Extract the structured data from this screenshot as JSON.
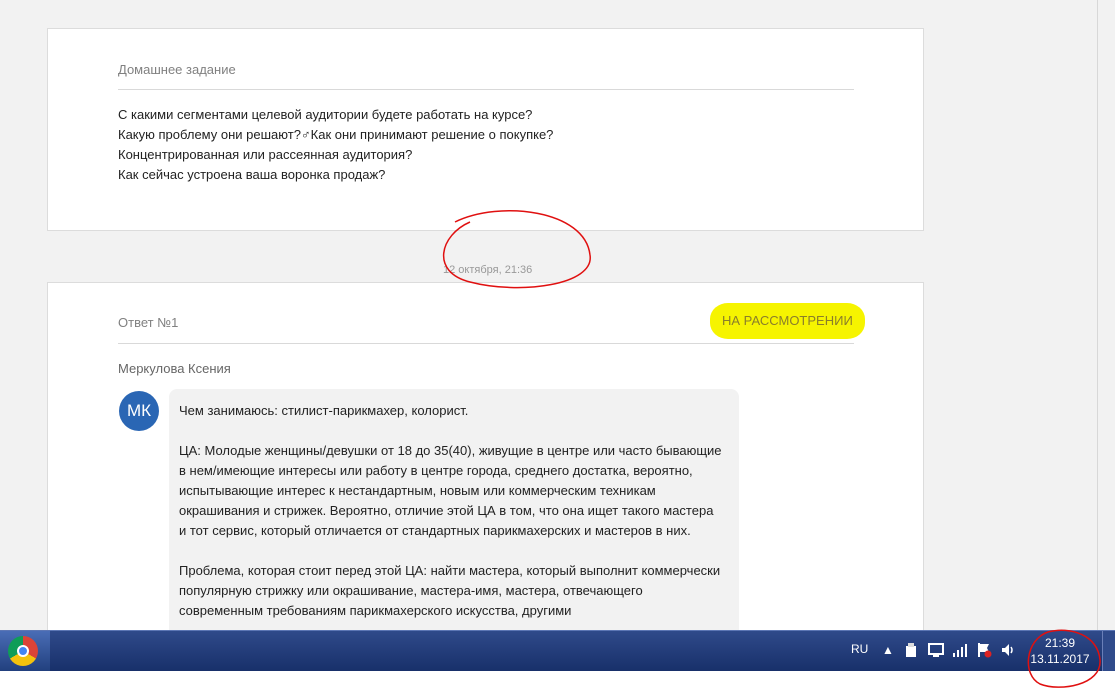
{
  "homework": {
    "title": "Домашнее задание",
    "lines": [
      "С какими сегментами целевой аудитории будете работать на курсе?",
      "Какую проблему они решают?♂Как они принимают решение о покупке?",
      "Концентрированная или рассеянная аудитория?",
      "Как сейчас устроена ваша воронка продаж?"
    ]
  },
  "timestamp": "12 октября, 21:36",
  "answer": {
    "label": "Ответ №1",
    "status": "НА РАССМОТРЕНИИ",
    "author": "Меркулова Ксения",
    "avatar_initials": "МК",
    "paragraphs": [
      "Чем занимаюсь: стилист-парикмахер, колорист.",
      "ЦА: Молодые женщины/девушки от 18 до 35(40), живущие в центре или часто бывающие в нем/имеющие интересы или работу в центре города, среднего достатка, вероятно, испытывающие интерес к нестандартным, новым или коммерческим техникам окрашивания и стрижек. Вероятно, отличие этой ЦА в том, что она ищет такого мастера и тот сервис, который отличается от стандартных парикмахерских и мастеров в них.",
      "Проблема, которая стоит перед этой ЦА: найти мастера, который выполнит коммерчески популярную стрижку или окрашивание, мастера-имя, мастера, отвечающего современным требованиям парикмахерского искусства, другими"
    ]
  },
  "taskbar": {
    "language": "RU",
    "clock_time": "21:39",
    "clock_date": "13.11.2017"
  },
  "colors": {
    "highlight": "#f6f400",
    "annotation": "#e01010",
    "avatar": "#2a66b4",
    "taskbar": "#1f3a78"
  }
}
